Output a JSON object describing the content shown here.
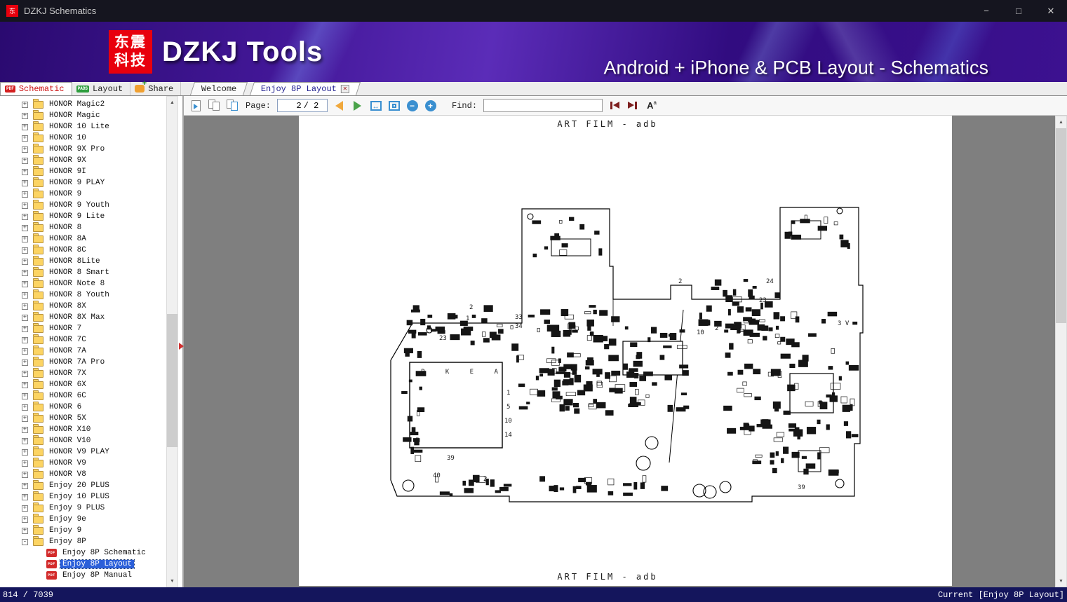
{
  "window": {
    "title": "DZKJ Schematics",
    "logo_text": "东",
    "minimize": "−",
    "maximize": "□",
    "close": "✕"
  },
  "banner": {
    "logo_line1": "东震",
    "logo_line2": "科技",
    "app_title": "DZKJ Tools",
    "subtitle": "Android + iPhone & PCB Layout - Schematics"
  },
  "ribbon_tabs": [
    {
      "label": "Schematic",
      "icon": "pdf",
      "active": true
    },
    {
      "label": "Layout",
      "icon": "pads",
      "active": false
    },
    {
      "label": "Share",
      "icon": "share",
      "active": false
    }
  ],
  "document_tabs": [
    {
      "label": "Welcome",
      "active": false,
      "closable": false
    },
    {
      "label": "Enjoy 8P Layout",
      "active": true,
      "closable": true
    }
  ],
  "toolbar": {
    "page_label": "Page:",
    "page_current": "2",
    "page_total": "/ 2",
    "find_label": "Find:",
    "find_value": "",
    "icons": [
      "single-page-view",
      "facing-pages-view",
      "book-view",
      "previous-page",
      "next-page",
      "fit-width",
      "fit-page",
      "zoom-out",
      "zoom-in",
      "find-previous",
      "find-next",
      "text-size"
    ]
  },
  "tree": {
    "items": [
      {
        "label": "HONOR Magic2",
        "type": "folder"
      },
      {
        "label": "HONOR Magic",
        "type": "folder"
      },
      {
        "label": "HONOR 10 Lite",
        "type": "folder"
      },
      {
        "label": "HONOR 10",
        "type": "folder"
      },
      {
        "label": "HONOR 9X Pro",
        "type": "folder"
      },
      {
        "label": "HONOR 9X",
        "type": "folder"
      },
      {
        "label": "HONOR 9I",
        "type": "folder"
      },
      {
        "label": "HONOR 9 PLAY",
        "type": "folder"
      },
      {
        "label": "HONOR 9",
        "type": "folder"
      },
      {
        "label": "HONOR 9 Youth",
        "type": "folder"
      },
      {
        "label": "HONOR 9 Lite",
        "type": "folder"
      },
      {
        "label": "HONOR 8",
        "type": "folder"
      },
      {
        "label": "HONOR 8A",
        "type": "folder"
      },
      {
        "label": "HONOR 8C",
        "type": "folder"
      },
      {
        "label": "HONOR 8Lite",
        "type": "folder"
      },
      {
        "label": "HONOR 8 Smart",
        "type": "folder"
      },
      {
        "label": "HONOR Note 8",
        "type": "folder"
      },
      {
        "label": "HONOR 8 Youth",
        "type": "folder"
      },
      {
        "label": "HONOR 8X",
        "type": "folder"
      },
      {
        "label": "HONOR 8X Max",
        "type": "folder"
      },
      {
        "label": "HONOR 7",
        "type": "folder"
      },
      {
        "label": "HONOR 7C",
        "type": "folder"
      },
      {
        "label": "HONOR 7A",
        "type": "folder"
      },
      {
        "label": "HONOR 7A Pro",
        "type": "folder"
      },
      {
        "label": "HONOR 7X",
        "type": "folder"
      },
      {
        "label": "HONOR 6X",
        "type": "folder"
      },
      {
        "label": "HONOR 6C",
        "type": "folder"
      },
      {
        "label": "HONOR 6",
        "type": "folder"
      },
      {
        "label": "HONOR 5X",
        "type": "folder"
      },
      {
        "label": "HONOR X10",
        "type": "folder"
      },
      {
        "label": "HONOR V10",
        "type": "folder"
      },
      {
        "label": "HONOR V9 PLAY",
        "type": "folder"
      },
      {
        "label": "HONOR V9",
        "type": "folder"
      },
      {
        "label": "HONOR V8",
        "type": "folder"
      },
      {
        "label": "Enjoy 20 PLUS",
        "type": "folder"
      },
      {
        "label": "Enjoy 10 PLUS",
        "type": "folder"
      },
      {
        "label": "Enjoy 9 PLUS",
        "type": "folder"
      },
      {
        "label": "Enjoy 9e",
        "type": "folder"
      },
      {
        "label": "Enjoy 9",
        "type": "folder"
      },
      {
        "label": "Enjoy 8P",
        "type": "folder",
        "expanded": true
      },
      {
        "label": "Enjoy 8P Schematic",
        "type": "pdf",
        "child": true
      },
      {
        "label": "Enjoy 8P Layout",
        "type": "pdf",
        "child": true,
        "selected": true
      },
      {
        "label": "Enjoy 8P Manual",
        "type": "pdf",
        "child": true
      }
    ]
  },
  "viewer": {
    "header_text": "ART FILM - adb",
    "footer_text": "ART FILM - adb",
    "chip_label": "P K E A",
    "chip_pins": [
      "1",
      "5",
      "10",
      "14"
    ],
    "annotations": [
      "23",
      "33",
      "34",
      "2",
      "1",
      "3",
      "10",
      "2",
      "24",
      "23",
      "2",
      "39",
      "40",
      "2",
      "39",
      "3 V"
    ]
  },
  "status_bar": {
    "left": "814 / 7039",
    "right": "Current [Enjoy 8P Layout]"
  },
  "colors": {
    "accent_red": "#e8000d",
    "banner_purple": "#44189a",
    "selection_blue": "#2b5fd9",
    "statusbar_navy": "#14155c"
  }
}
